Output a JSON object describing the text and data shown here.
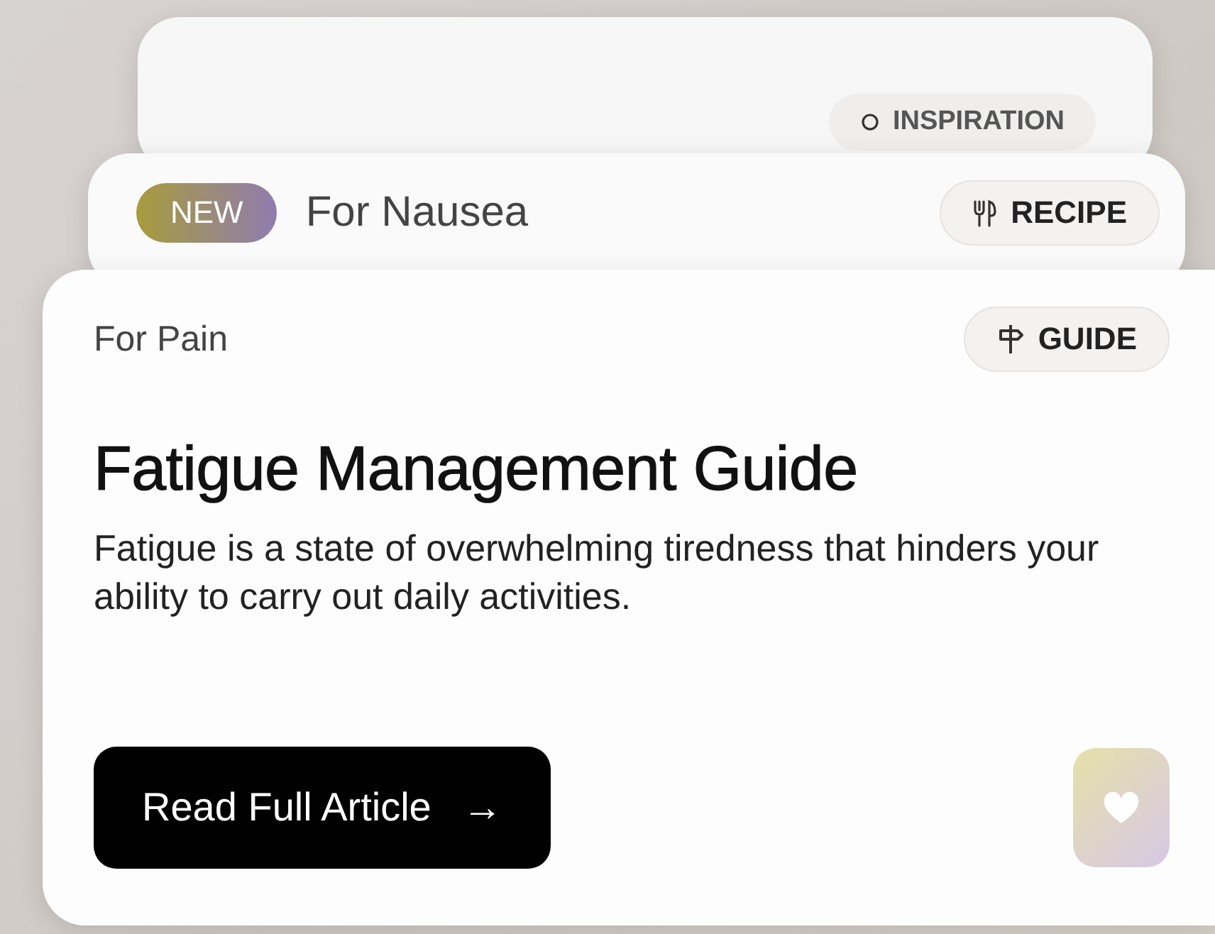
{
  "cards": [
    {
      "kind": "inspiration",
      "tag": "INSPIRATION"
    },
    {
      "kind": "recipe",
      "badge": "NEW",
      "category": "For Nausea",
      "tag": "RECIPE"
    },
    {
      "kind": "guide",
      "category": "For Pain",
      "tag": "GUIDE",
      "title": "Fatigue Management Guide",
      "description": "Fatigue is a state of overwhelming tiredness that hinders your ability to carry out daily activities.",
      "button": {
        "label": "Read Full Article",
        "arrow": "→"
      }
    }
  ]
}
